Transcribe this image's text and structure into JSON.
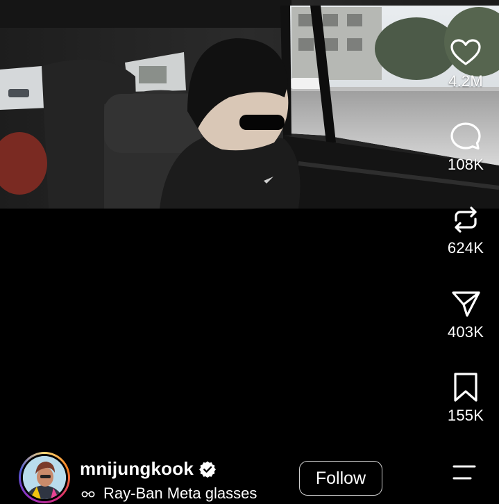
{
  "video": {
    "description_visible": false
  },
  "actions": [
    {
      "id": "like",
      "icon": "heart-icon",
      "count": "4.2M"
    },
    {
      "id": "comment",
      "icon": "comment-bubble-icon",
      "count": "108K"
    },
    {
      "id": "repost",
      "icon": "repost-icon",
      "count": "624K"
    },
    {
      "id": "share",
      "icon": "send-icon",
      "count": "403K"
    },
    {
      "id": "save",
      "icon": "bookmark-icon",
      "count": "155K"
    }
  ],
  "author": {
    "username": "mnijungkook",
    "verified": true,
    "subtitle_icon": "glasses-icon",
    "subtitle": "Ray-Ban Meta glasses",
    "follow_label": "Follow",
    "menu_icon": "menu-icon"
  },
  "colors": {
    "background": "#000000",
    "text": "#ffffff",
    "follow_border": "#cfcfcf",
    "story_ring": [
      "#feda75",
      "#fa7e1e",
      "#d62976",
      "#962fbf",
      "#4f5bd5"
    ]
  }
}
